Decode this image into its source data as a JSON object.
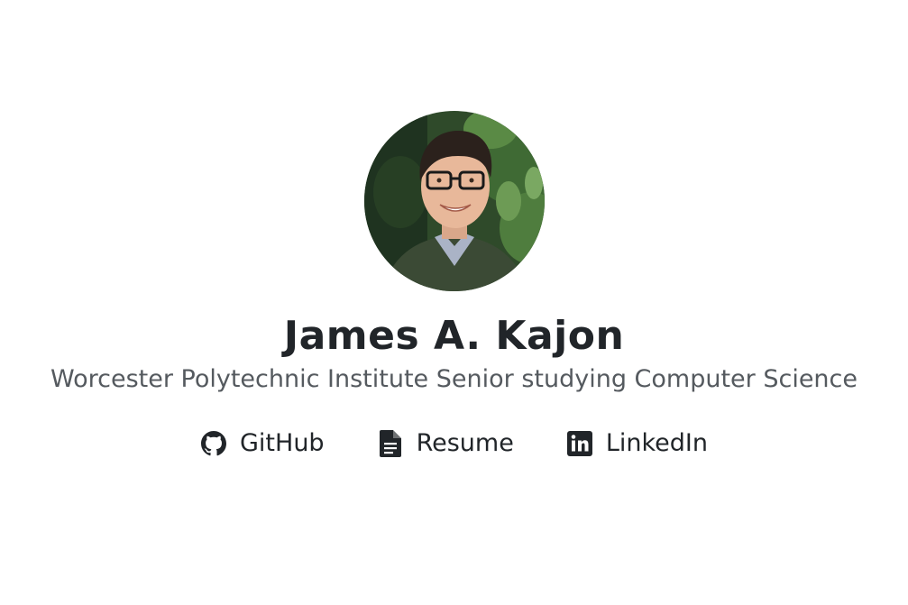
{
  "profile": {
    "name": "James A. Kajon",
    "subtitle": "Worcester Polytechnic Institute Senior studying Computer Science"
  },
  "links": [
    {
      "label": "GitHub",
      "icon": "github-icon"
    },
    {
      "label": "Resume",
      "icon": "document-icon"
    },
    {
      "label": "LinkedIn",
      "icon": "linkedin-icon"
    }
  ],
  "colors": {
    "text": "#212529",
    "subtitle": "#555a5f",
    "background": "#ffffff"
  }
}
